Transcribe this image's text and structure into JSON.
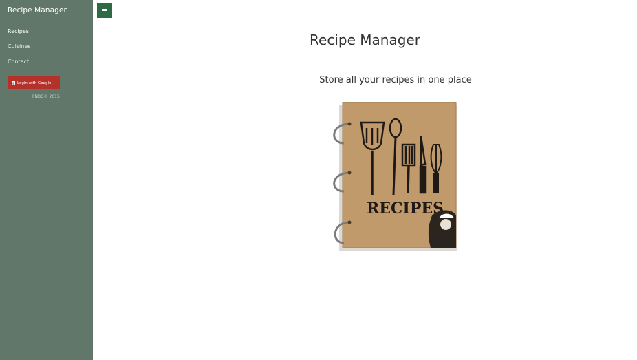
{
  "sidebar": {
    "brand": "Recipe Manager",
    "nav": [
      {
        "label": "Recipes",
        "active": true
      },
      {
        "label": "Cuisines",
        "active": false
      },
      {
        "label": "Contact",
        "active": false
      }
    ],
    "login_button_label": "Login with Google",
    "login_icon": "google-icon",
    "copyright": "FNBG© 2015"
  },
  "toolbar": {
    "menu_icon": "hamburger-menu-icon"
  },
  "main": {
    "title": "Recipe Manager",
    "subtitle": "Store all your recipes in one place",
    "hero_image_text": "RECIPES"
  },
  "colors": {
    "sidebar_bg": "#60776a",
    "toggle_bg": "#2e6b45",
    "login_bg": "#b5322a",
    "notebook_cover": "#c09a6a"
  }
}
